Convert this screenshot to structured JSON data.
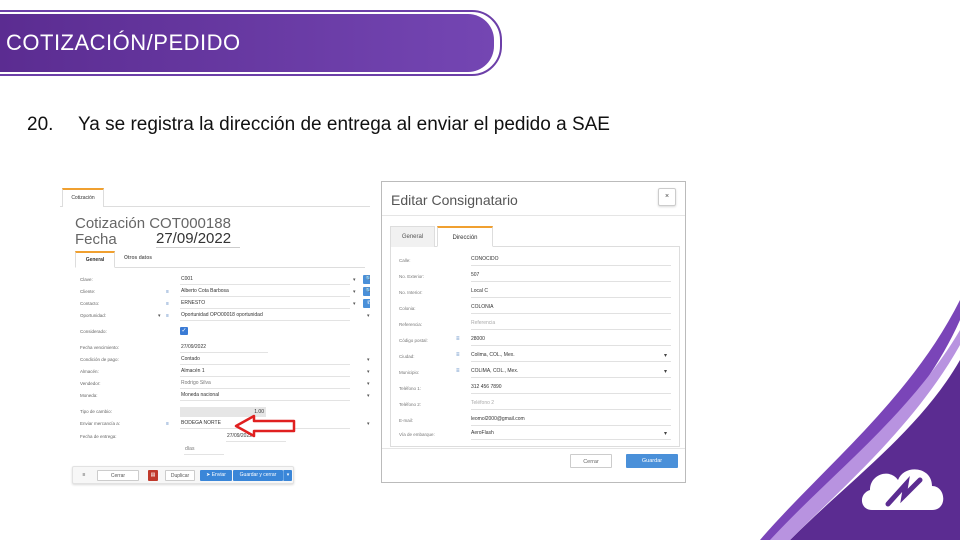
{
  "slide": {
    "header_title": "COTIZACIÓN/PEDIDO",
    "step_number": "20.",
    "step_text": "Ya se registra la dirección de entrega al enviar el pedido a SAE"
  },
  "cotizacion": {
    "tab_label": "Cotización",
    "title": "Cotización COT000188",
    "fecha_label": "Fecha",
    "fecha_value": "27/09/2022",
    "inner_tabs": [
      "General",
      "Otros datos"
    ],
    "fields": [
      {
        "label": "Clave:",
        "value": "C001"
      },
      {
        "label": "Cliente:",
        "value": "Alberto Cota Barbosa"
      },
      {
        "label": "Contacto:",
        "value": "ERNESTO"
      },
      {
        "label": "Oportunidad:",
        "value": "Oportunidad OPO00018 oportunidad"
      },
      {
        "label": "Considerado:",
        "value": ""
      },
      {
        "label": "Fecha vencimiento:",
        "value": "27/09/2022"
      },
      {
        "label": "Condición de pago:",
        "value": "Contado"
      },
      {
        "label": "Almacén:",
        "value": "Almacén 1"
      },
      {
        "label": "Vendedor:",
        "value": "Rodrigo Silva"
      },
      {
        "label": "Moneda:",
        "value": "Moneda nacional"
      },
      {
        "label": "Tipo de cambio:",
        "value": "1.00"
      },
      {
        "label": "Enviar mercancía a:",
        "value": "BODEGA NORTE"
      },
      {
        "label": "Fecha de entrega:",
        "value": "27/09/2022"
      }
    ],
    "dias_label": "días",
    "footer": {
      "menu_icon": "≡",
      "cerrar": "Cerrar",
      "duplicar": "Duplicar",
      "enviar": "Enviar",
      "guardar_cerrar": "Guardar y cerrar"
    }
  },
  "consignatario": {
    "title": "Editar Consignatario",
    "close": "×",
    "tabs": [
      "General",
      "Dirección"
    ],
    "fields": [
      {
        "label": "Calle:",
        "value": "CONOCIDO"
      },
      {
        "label": "No. Exterior:",
        "value": "507"
      },
      {
        "label": "No. Interior:",
        "value": "Local C"
      },
      {
        "label": "Colonia:",
        "value": "COLONIA"
      },
      {
        "label": "Referencia:",
        "value": "Referencia"
      },
      {
        "label": "Código postal:",
        "value": "28000"
      },
      {
        "label": "Ciudad:",
        "value": "Colima, COL., Mex."
      },
      {
        "label": "Municipio:",
        "value": "COLIMA, COL., Mex."
      },
      {
        "label": "Teléfono 1:",
        "value": "312 456 7890"
      },
      {
        "label": "Teléfono 2:",
        "value": "Teléfono 2"
      },
      {
        "label": "E-mail:",
        "value": "leomol2000@gmail.com"
      },
      {
        "label": "Vía de embarque:",
        "value": "AeroFlash"
      }
    ],
    "buttons": {
      "cerrar": "Cerrar",
      "guardar": "Guardar"
    }
  },
  "colors": {
    "brand": "#5b2c91",
    "accent": "#f0a030",
    "primary_button": "#4a90d9",
    "arrow": "#e02020"
  }
}
